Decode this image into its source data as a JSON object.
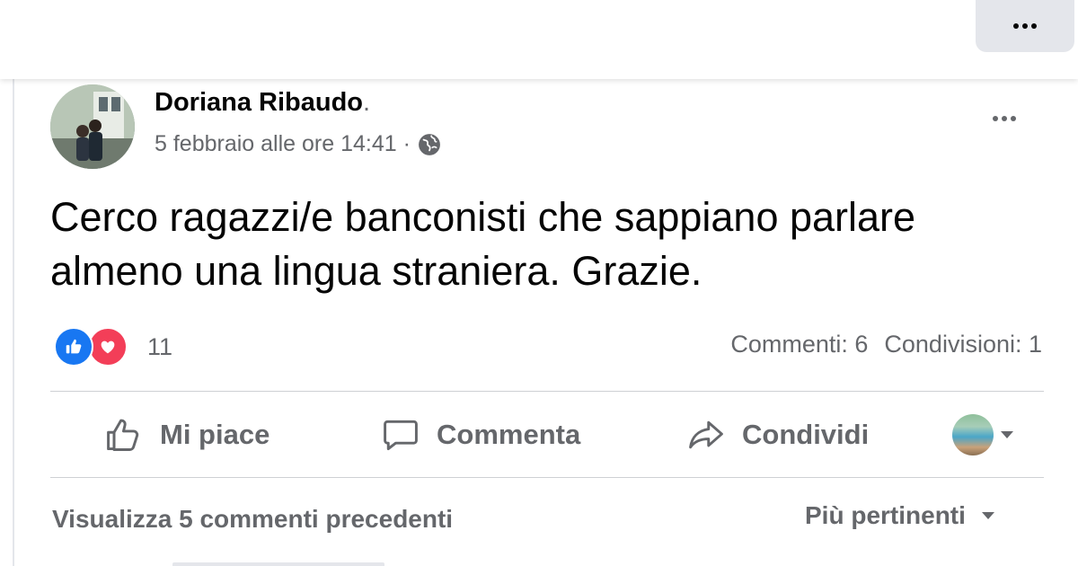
{
  "post": {
    "author": "Doriana Ribaudo",
    "author_suffix": ".",
    "timestamp": "5 febbraio alle ore 14:41 ·",
    "audience_icon": "globe-icon",
    "text": "Cerco ragazzi/e banconisti che sappiano parlare almeno una lingua straniera. Grazie."
  },
  "reactions": {
    "types": [
      "like-icon",
      "love-icon"
    ],
    "count": "11",
    "like_color": "#1877f2",
    "love_color": "#f33e58"
  },
  "stats": {
    "comments": "Commenti: 6",
    "shares": "Condivisioni: 1"
  },
  "actions": {
    "like_label": "Mi piace",
    "comment_label": "Commenta",
    "share_label": "Condividi"
  },
  "comments": {
    "view_previous": "Visualizza 5 commenti precedenti",
    "sort_label": "Più pertinenti"
  }
}
